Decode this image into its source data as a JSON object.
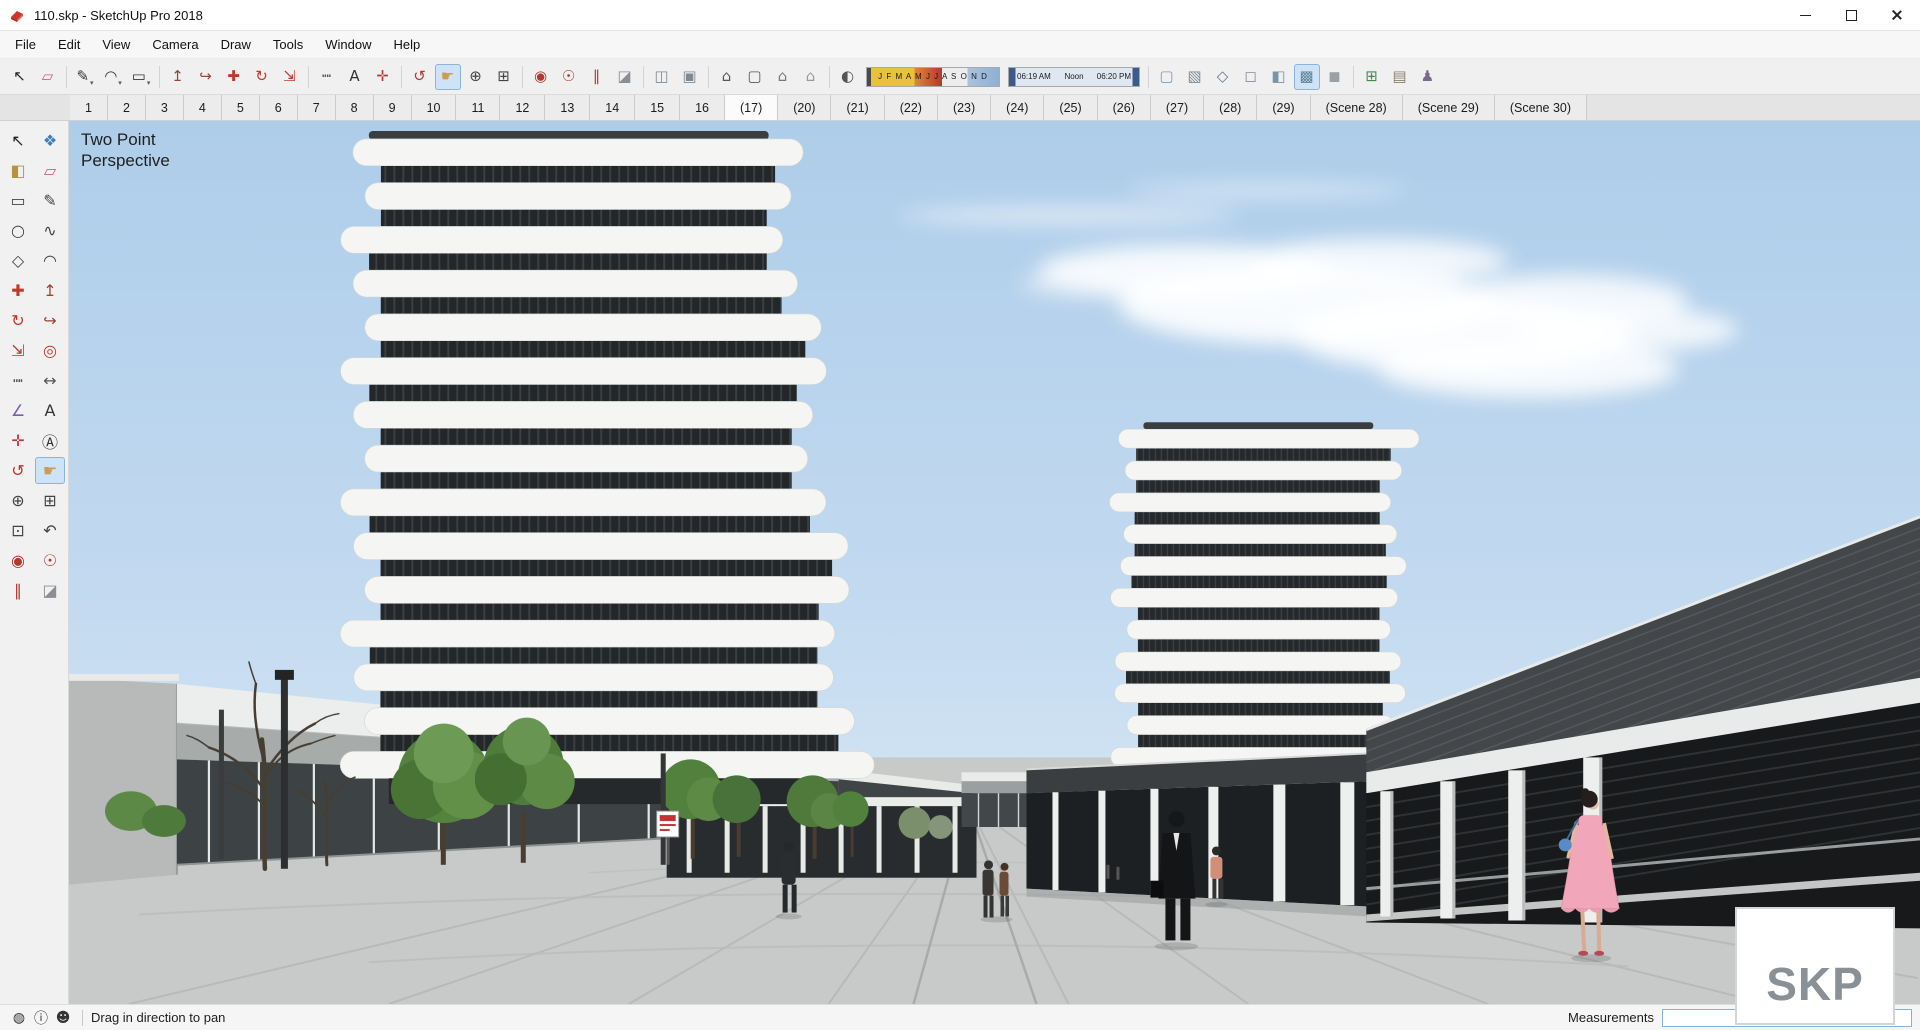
{
  "window": {
    "title": "110.skp - SketchUp Pro 2018"
  },
  "menu_bar": {
    "items": [
      {
        "label": "File",
        "name": "menu-file"
      },
      {
        "label": "Edit",
        "name": "menu-edit"
      },
      {
        "label": "View",
        "name": "menu-view"
      },
      {
        "label": "Camera",
        "name": "menu-camera"
      },
      {
        "label": "Draw",
        "name": "menu-draw"
      },
      {
        "label": "Tools",
        "name": "menu-tools"
      },
      {
        "label": "Window",
        "name": "menu-window"
      },
      {
        "label": "Help",
        "name": "menu-help"
      }
    ]
  },
  "toolbar": {
    "left_items": [
      {
        "name": "select-tool",
        "glyph": "↖",
        "color": "#222222"
      },
      {
        "name": "eraser-tool",
        "glyph": "▱",
        "color": "#c95f81"
      },
      {
        "cls": "sep"
      },
      {
        "name": "line-tool",
        "glyph": "✎",
        "color": "#333333",
        "dd": "▾"
      },
      {
        "name": "arc-tool",
        "glyph": "◠",
        "color": "#333333",
        "dd": "▾"
      },
      {
        "name": "shapes-tool",
        "glyph": "▭",
        "color": "#333333",
        "dd": "▾"
      },
      {
        "cls": "sep"
      },
      {
        "name": "push-pull-tool",
        "glyph": "↥",
        "color": "#9c4632"
      },
      {
        "name": "follow-me-tool",
        "glyph": "↪",
        "color": "#9c4632"
      },
      {
        "name": "move-tool",
        "glyph": "✚",
        "color": "#c0392b"
      },
      {
        "name": "rotate-tool",
        "glyph": "↻",
        "color": "#c0392b"
      },
      {
        "name": "scale-tool",
        "glyph": "⇲",
        "color": "#c0392b"
      },
      {
        "cls": "sep"
      },
      {
        "name": "tape-measure-tool",
        "glyph": "┉",
        "color": "#555555"
      },
      {
        "name": "text-tool",
        "glyph": "A",
        "color": "#333333"
      },
      {
        "name": "axes-tool",
        "glyph": "✛",
        "color": "#b33939"
      },
      {
        "cls": "sep"
      },
      {
        "name": "orbit-tool",
        "glyph": "↺",
        "color": "#b03a2e"
      },
      {
        "name": "pan-tool",
        "glyph": "☛",
        "color": "#c99d55",
        "selected": true
      },
      {
        "name": "zoom-tool",
        "glyph": "⊕",
        "color": "#444444"
      },
      {
        "name": "zoom-window-tool",
        "glyph": "⊞",
        "color": "#444444"
      },
      {
        "cls": "sep"
      },
      {
        "name": "position-camera-tool",
        "glyph": "◉",
        "color": "#b03a2e"
      },
      {
        "name": "look-around-tool",
        "glyph": "☉",
        "color": "#b03a2e"
      },
      {
        "name": "walk-tool",
        "glyph": "∥",
        "color": "#b03a2e"
      },
      {
        "name": "section-plane-tool",
        "glyph": "◪",
        "color": "#8a8f94"
      },
      {
        "cls": "sep"
      },
      {
        "name": "display-section-planes-toggle",
        "glyph": "◫",
        "color": "#7f8a94"
      },
      {
        "name": "display-section-cuts-toggle",
        "glyph": "▣",
        "color": "#7f8a94"
      },
      {
        "cls": "sep"
      },
      {
        "name": "iso-view-button",
        "glyph": "⌂",
        "color": "#555555"
      },
      {
        "name": "top-view-button",
        "glyph": "▢",
        "color": "#555555"
      },
      {
        "name": "front-view-button",
        "glyph": "⌂",
        "color": "#777777"
      },
      {
        "name": "right-view-button",
        "glyph": "⌂",
        "color": "#999999"
      },
      {
        "cls": "sep"
      },
      {
        "name": "shadows-toggle",
        "glyph": "◐",
        "color": "#555555"
      }
    ],
    "shadow_widget": {
      "months": "J F M A M J J A S O N D",
      "time_start": "06:19 AM",
      "time_noon": "Noon",
      "time_end": "06:20 PM"
    },
    "right_items": [
      {
        "cls": "sep"
      },
      {
        "name": "xray-style-button",
        "glyph": "▢",
        "color": "#7a9ab5"
      },
      {
        "name": "back-edges-style-button",
        "glyph": "▧",
        "color": "#7a8a99"
      },
      {
        "name": "wireframe-style-button",
        "glyph": "◇",
        "color": "#667788"
      },
      {
        "name": "hidden-line-style-button",
        "glyph": "◻",
        "color": "#888899"
      },
      {
        "name": "shaded-style-button",
        "glyph": "◧",
        "color": "#7a93a8"
      },
      {
        "name": "shaded-textures-style-button",
        "glyph": "▩",
        "color": "#5f7f98",
        "selected": true
      },
      {
        "name": "monochrome-style-button",
        "glyph": "◼",
        "color": "#9aa0a4"
      },
      {
        "cls": "sep"
      },
      {
        "name": "components-panel-button",
        "glyph": "⊞",
        "color": "#3f8a4f"
      },
      {
        "name": "materials-panel-button",
        "glyph": "▤",
        "color": "#8a7f6a"
      },
      {
        "name": "warehouse-button",
        "glyph": "♟",
        "color": "#7a6a8a"
      }
    ]
  },
  "scene_tabs": {
    "tabs": [
      {
        "label": "1"
      },
      {
        "label": "2"
      },
      {
        "label": "3"
      },
      {
        "label": "4"
      },
      {
        "label": "5"
      },
      {
        "label": "6"
      },
      {
        "label": "7"
      },
      {
        "label": "8"
      },
      {
        "label": "9"
      },
      {
        "label": "10"
      },
      {
        "label": "11"
      },
      {
        "label": "12"
      },
      {
        "label": "13"
      },
      {
        "label": "14"
      },
      {
        "label": "15"
      },
      {
        "label": "16"
      },
      {
        "label": "(17)",
        "selected": true
      },
      {
        "label": "(20)"
      },
      {
        "label": "(21)"
      },
      {
        "label": "(22)"
      },
      {
        "label": "(23)"
      },
      {
        "label": "(24)"
      },
      {
        "label": "(25)"
      },
      {
        "label": "(26)"
      },
      {
        "label": "(27)"
      },
      {
        "label": "(28)"
      },
      {
        "label": "(29)"
      },
      {
        "label": "(Scene 28)"
      },
      {
        "label": "(Scene 29)"
      },
      {
        "label": "(Scene 30)"
      }
    ]
  },
  "tool_palette": {
    "tools": [
      {
        "name": "select-tool",
        "glyph": "↖",
        "color": "#222222"
      },
      {
        "name": "make-component-tool",
        "glyph": "❖",
        "color": "#3f7fbf"
      },
      {
        "name": "paint-bucket-tool",
        "glyph": "◧",
        "color": "#b8923e"
      },
      {
        "name": "eraser-tool",
        "glyph": "▱",
        "color": "#c95f81"
      },
      {
        "name": "rectangle-tool",
        "glyph": "▭",
        "color": "#444444"
      },
      {
        "name": "line-tool",
        "glyph": "✎",
        "color": "#444444"
      },
      {
        "name": "circle-tool",
        "glyph": "○",
        "color": "#444444"
      },
      {
        "name": "freehand-tool",
        "glyph": "∿",
        "color": "#444444"
      },
      {
        "name": "polygon-tool",
        "glyph": "◇",
        "color": "#444444"
      },
      {
        "name": "arc-tool",
        "glyph": "◠",
        "color": "#444444"
      },
      {
        "name": "move-tool",
        "glyph": "✚",
        "color": "#c0392b"
      },
      {
        "name": "push-pull-tool",
        "glyph": "↥",
        "color": "#9c4632"
      },
      {
        "name": "rotate-tool",
        "glyph": "↻",
        "color": "#c0392b"
      },
      {
        "name": "follow-me-tool",
        "glyph": "↪",
        "color": "#9c4632"
      },
      {
        "name": "scale-tool",
        "glyph": "⇲",
        "color": "#c0392b"
      },
      {
        "name": "offset-tool",
        "glyph": "◎",
        "color": "#c0392b"
      },
      {
        "name": "tape-measure-tool",
        "glyph": "┉",
        "color": "#555555"
      },
      {
        "name": "dimension-tool",
        "glyph": "↔",
        "color": "#555555"
      },
      {
        "name": "protractor-tool",
        "glyph": "∠",
        "color": "#7a5fae"
      },
      {
        "name": "text-tool",
        "glyph": "A",
        "color": "#333333"
      },
      {
        "name": "axes-tool",
        "glyph": "✛",
        "color": "#b33939"
      },
      {
        "name": "3d-text-tool",
        "glyph": "Ⓐ",
        "color": "#333333"
      },
      {
        "name": "orbit-tool",
        "glyph": "↺",
        "color": "#b03a2e"
      },
      {
        "name": "pan-tool",
        "glyph": "☛",
        "color": "#c99d55",
        "selected": true
      },
      {
        "name": "zoom-tool",
        "glyph": "⊕",
        "color": "#444444"
      },
      {
        "name": "zoom-window-tool",
        "glyph": "⊞",
        "color": "#444444"
      },
      {
        "name": "zoom-extents-tool",
        "glyph": "⊡",
        "color": "#444444"
      },
      {
        "name": "previous-view-tool",
        "glyph": "↶",
        "color": "#444444"
      },
      {
        "name": "position-camera-tool",
        "glyph": "◉",
        "color": "#b03a2e"
      },
      {
        "name": "look-around-tool",
        "glyph": "☉",
        "color": "#b03a2e"
      },
      {
        "name": "walk-tool",
        "glyph": "∥",
        "color": "#b03a2e"
      },
      {
        "name": "section-plane-tool",
        "glyph": "◪",
        "color": "#8a8f94"
      }
    ]
  },
  "viewport": {
    "perspective_label_line1": "Two Point",
    "perspective_label_line2": "Perspective",
    "watermark": "SKP",
    "sky_color": "#aecdea",
    "ground_color": "#c7cac8"
  },
  "status_bar": {
    "icons": [
      {
        "name": "geolocation-icon",
        "glyph": "◍"
      },
      {
        "name": "credits-icon",
        "glyph": "ⓘ"
      },
      {
        "name": "user-icon",
        "glyph": "☻"
      }
    ],
    "hint": "Drag in direction to pan",
    "measurements_label": "Measurements",
    "measurements_value": ""
  }
}
